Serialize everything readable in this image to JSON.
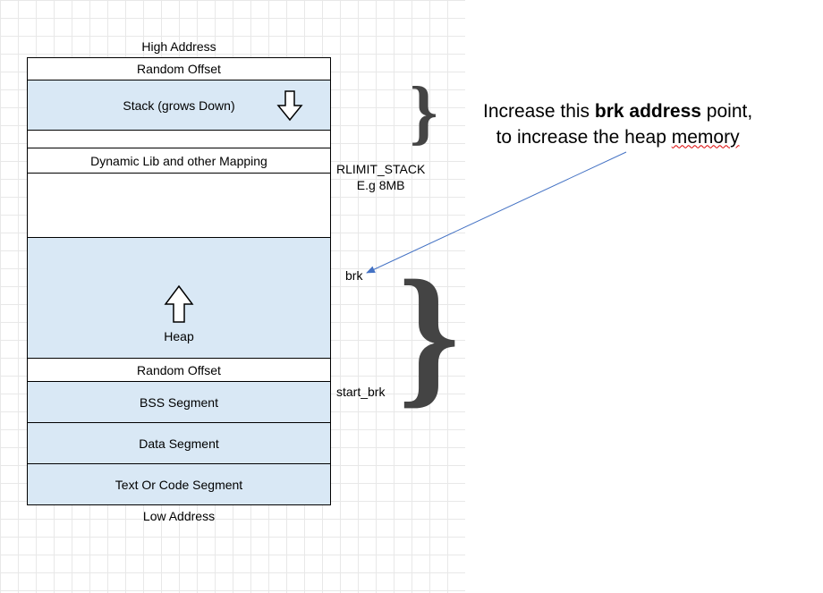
{
  "labels": {
    "high_addr": "High Address",
    "low_addr": "Low Address",
    "random_offset_top": "Random Offset",
    "stack": "Stack (grows Down)",
    "dynlib": "Dynamic Lib and other Mapping",
    "heap": "Heap",
    "random_offset_bottom": "Random Offset",
    "bss": "BSS Segment",
    "data": "Data Segment",
    "text": "Text Or Code Segment",
    "rlimit_line1": "RLIMIT_STACK",
    "rlimit_line2": "E.g 8MB",
    "brk": "brk",
    "start_brk": "start_brk"
  },
  "annotation": {
    "part1": "Increase this ",
    "bold": "brk address",
    "part2": " point,",
    "line2_a": "to increase the heap ",
    "line2_b": "memory"
  },
  "colors": {
    "shade": "#d9e8f5",
    "grid": "#e8e8e8",
    "brace": "#444444",
    "arrow_line": "#4472c4"
  }
}
